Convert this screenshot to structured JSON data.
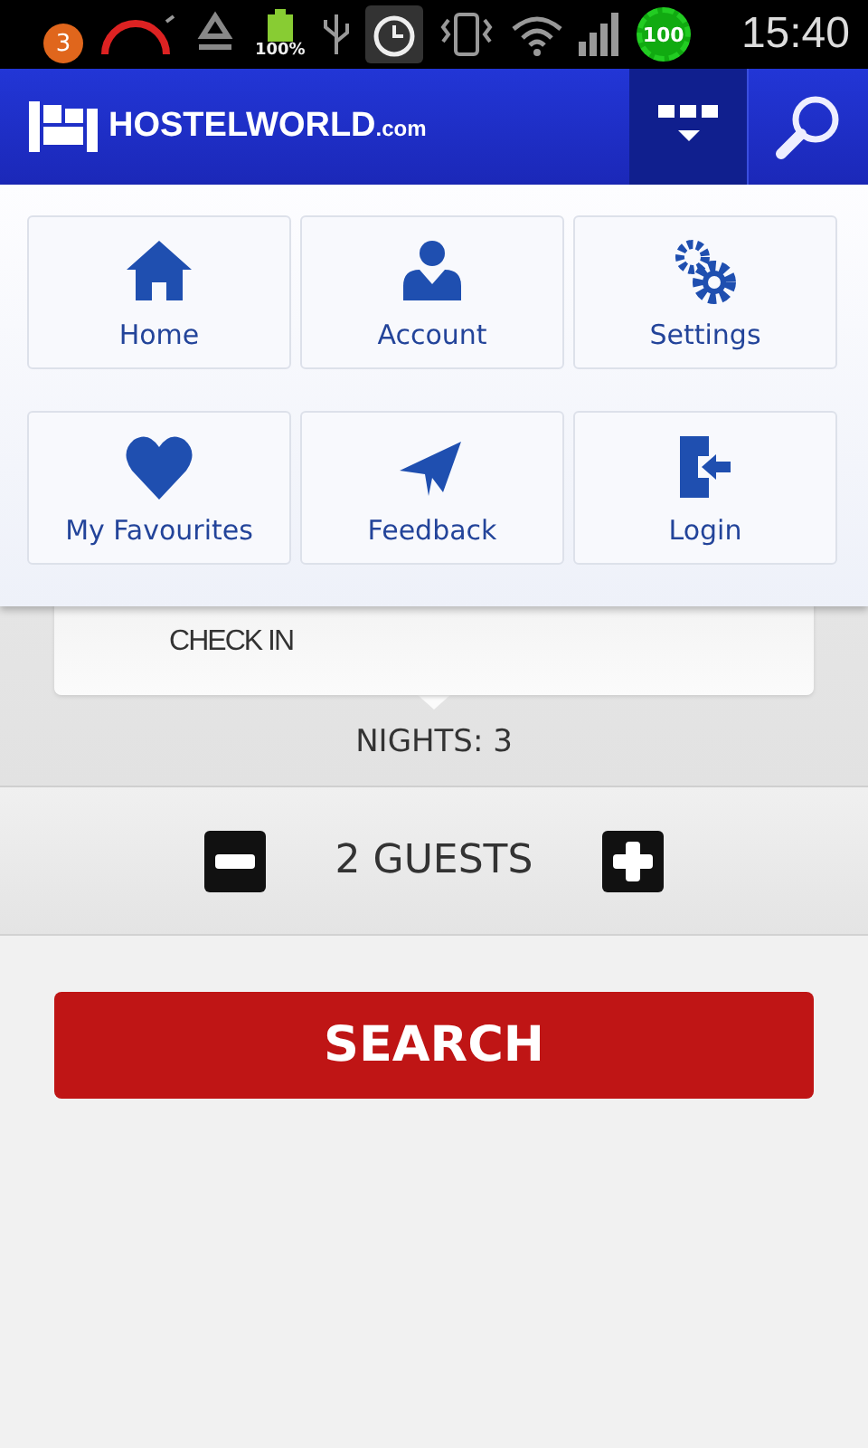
{
  "status_bar": {
    "notification_count": "3",
    "battery_label": "100%",
    "badge_value": "100",
    "time": "15:40"
  },
  "app_bar": {
    "logo_text": "HOSTELWORLD",
    "logo_suffix": ".com",
    "menu_expanded": true
  },
  "menu": [
    {
      "label": "Home",
      "kind": "home"
    },
    {
      "label": "Account",
      "kind": "account"
    },
    {
      "label": "Settings",
      "kind": "settings"
    },
    {
      "label": "My Favourites",
      "kind": "favourites"
    },
    {
      "label": "Feedback",
      "kind": "feedback"
    },
    {
      "label": "Login",
      "kind": "login"
    }
  ],
  "check_in": {
    "label": "CHECK IN"
  },
  "nights": "NIGHTS: 3",
  "guests": "2 GUESTS",
  "search_button": "SEARCH"
}
